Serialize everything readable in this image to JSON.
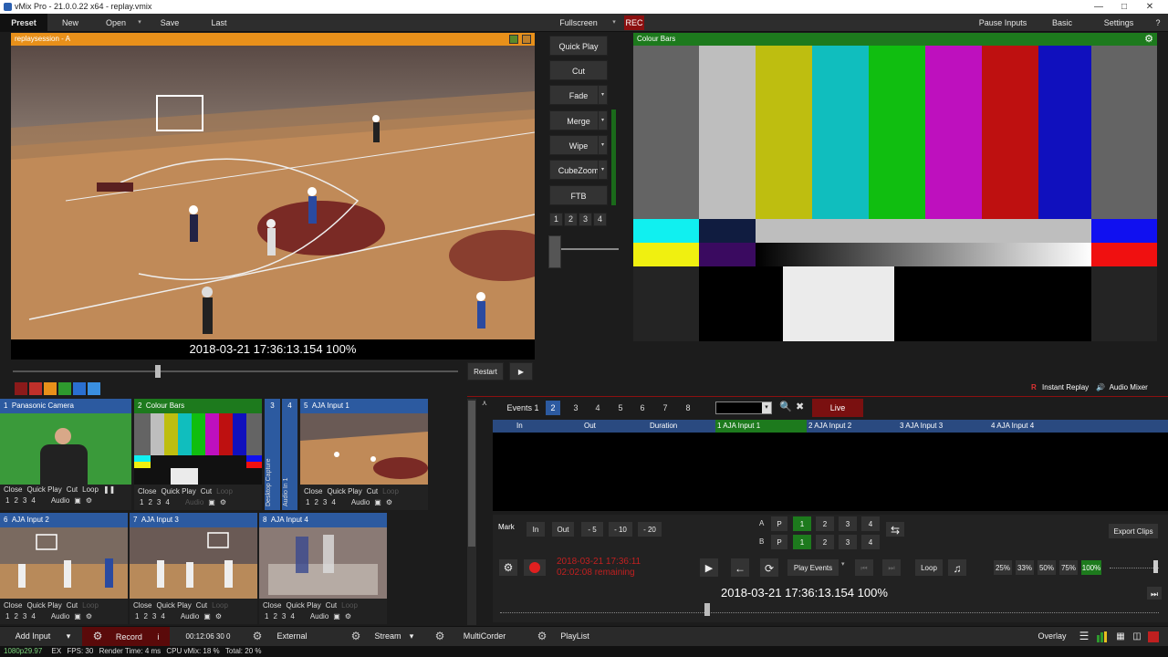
{
  "window": {
    "title": "vMix Pro - 21.0.0.22 x64 - replay.vmix"
  },
  "menu": {
    "preset": "Preset",
    "new": "New",
    "open": "Open",
    "save": "Save",
    "last": "Last",
    "fullscreen": "Fullscreen",
    "rec": "REC",
    "pause_inputs": "Pause Inputs",
    "basic": "Basic",
    "settings": "Settings",
    "help": "?"
  },
  "preview": {
    "label": "replaysession - A",
    "timestamp": "2018-03-21 17:36:13.154  100%",
    "restart": "Restart"
  },
  "transitions": {
    "quick_play": "Quick Play",
    "cut": "Cut",
    "fade": "Fade",
    "merge": "Merge",
    "wipe": "Wipe",
    "cubezoom": "CubeZoom",
    "ftb": "FTB",
    "nums": [
      "1",
      "2",
      "3",
      "4"
    ]
  },
  "output": {
    "label": "Colour Bars"
  },
  "colors": {
    "accent_orange": "#e8901a",
    "header_green": "#1d7a1d",
    "tile_blue": "#2c5aa0",
    "rec_red": "#8b1010"
  },
  "swatches": [
    "#8b1a1a",
    "#c0302a",
    "#e8901a",
    "#2e9a2e",
    "#2a6fd0",
    "#3a8fe0"
  ],
  "inputs": [
    {
      "num": "1",
      "name": "Panasonic Camera"
    },
    {
      "num": "2",
      "name": "Colour Bars"
    },
    {
      "num": "3",
      "name": "Desktop Capture"
    },
    {
      "num": "4",
      "name": "Audio In 1"
    },
    {
      "num": "5",
      "name": "AJA Input 1"
    },
    {
      "num": "6",
      "name": "AJA Input 2"
    },
    {
      "num": "7",
      "name": "AJA Input 3"
    },
    {
      "num": "8",
      "name": "AJA Input 4"
    }
  ],
  "tile_controls": {
    "close": "Close",
    "quick_play": "Quick Play",
    "cut": "Cut",
    "loop": "Loop",
    "audio": "Audio",
    "nums": [
      "1",
      "2",
      "3",
      "4"
    ]
  },
  "replay": {
    "tab_instant_replay": "Instant Replay",
    "tab_audio_mixer": "Audio Mixer",
    "events_tab": "Events 1",
    "event_nums": [
      "2",
      "3",
      "4",
      "5",
      "6",
      "7",
      "8"
    ],
    "live": "Live",
    "columns": [
      "In",
      "Out",
      "Duration",
      "1 AJA Input 1",
      "2 AJA Input 2",
      "3 AJA Input 3",
      "4 AJA Input 4"
    ],
    "mark": "Mark",
    "in": "In",
    "out": "Out",
    "jumps": [
      "- 5",
      "- 10",
      "- 20"
    ],
    "row_a": "A",
    "row_b": "B",
    "p": "P",
    "cams": [
      "1",
      "2",
      "3",
      "4"
    ],
    "export_clips": "Export Clips",
    "rec_time": "2018-03-21 17:36:11",
    "remaining": "02:02:08 remaining",
    "play_events": "Play Events",
    "loop": "Loop",
    "speeds": [
      "25%",
      "33%",
      "50%",
      "75%",
      "100%"
    ],
    "timestamp": "2018-03-21 17:36:13.154  100%"
  },
  "bottom": {
    "add_input": "Add Input",
    "record": "Record",
    "record_i": "i",
    "record_time": "00:12:06 30 0",
    "external": "External",
    "stream": "Stream",
    "multicorder": "MultiCorder",
    "playlist": "PlayList",
    "overlay": "Overlay"
  },
  "status": {
    "resolution": "1080p29.97",
    "ex": "EX",
    "fps_label": "FPS:",
    "fps": "30",
    "render_label": "Render Time:",
    "render": "4 ms",
    "cpu_label": "CPU vMix:",
    "cpu": "18 %",
    "total_label": "Total:",
    "total": "20 %"
  }
}
